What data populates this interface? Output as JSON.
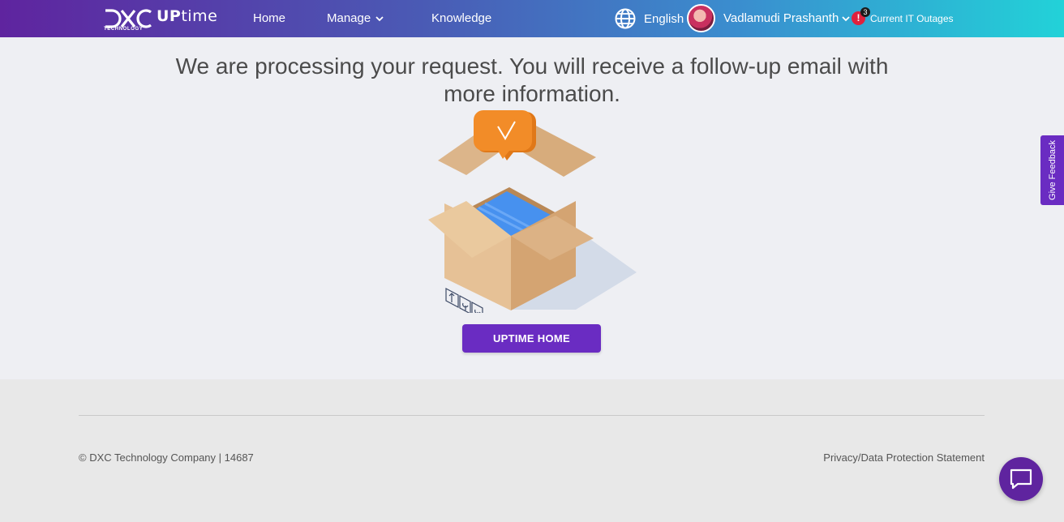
{
  "header": {
    "logo_text": "DXC",
    "logo_subtext": "TECHNOLOGY",
    "brand_prefix": "UP",
    "brand_suffix": "time",
    "nav": {
      "home": "Home",
      "manage": "Manage",
      "knowledge": "Knowledge"
    },
    "language": "English",
    "user_name": "Vadlamudi Prashanth",
    "alert_symbol": "!",
    "alert_count": "3",
    "outages_label": "Current IT Outages"
  },
  "main": {
    "message": "We are processing your request. You will receive a follow-up email with more information.",
    "home_button": "UPTIME HOME"
  },
  "feedback_tab": "Give Feedback",
  "footer": {
    "copyright": "© DXC Technology Company | 14687",
    "privacy": "Privacy/Data Protection Statement"
  },
  "colors": {
    "accent": "#6a2cc2",
    "brand_purple": "#5f249f",
    "header_end": "#22d2d8",
    "alert_red": "#e0213d",
    "balloon_orange": "#f08a24",
    "package_blue": "#2f6fdc"
  },
  "icons": [
    "globe-icon",
    "chevron-down-icon",
    "alert-icon",
    "chat-icon",
    "check-icon"
  ]
}
